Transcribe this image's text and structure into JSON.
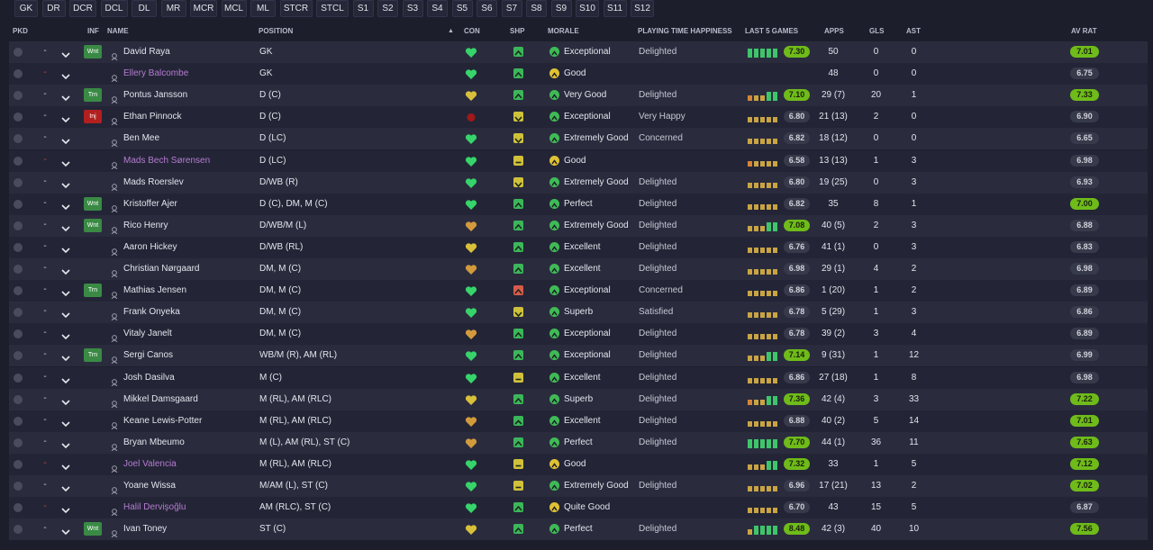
{
  "tabs": [
    "GK",
    "DR",
    "DCR",
    "DCL",
    "DL",
    "MR",
    "MCR",
    "MCL",
    "ML",
    "STCR",
    "STCL",
    "S1",
    "S2",
    "S3",
    "S4",
    "S5",
    "S6",
    "S7",
    "S8",
    "S9",
    "S10",
    "S11",
    "S12"
  ],
  "headers": {
    "pkd": "PKD",
    "inf": "INF",
    "name": "NAME",
    "position": "POSITION",
    "sort_arrow": "▲",
    "con": "CON",
    "shp": "SHP",
    "morale": "MORALE",
    "playing_time_happiness": "PLAYING TIME HAPPINESS",
    "last5": "LAST 5 GAMES",
    "apps": "APPS",
    "gls": "GLS",
    "ast": "AST",
    "avrat": "AV RAT"
  },
  "colors": {
    "accent_green": "#4caf50",
    "rating_green": "#6fbb1a",
    "rating_dark": "#373a4a",
    "loan_purple": "#b57bd1",
    "injury_red": "#b21f1f"
  },
  "players": [
    {
      "name": "David Raya",
      "loan": false,
      "status": "Wnt",
      "position": "GK",
      "con": "green",
      "shp": "up",
      "mood": "green",
      "morale": "Exceptional",
      "pth": "Delighted",
      "form": [
        3,
        3,
        3,
        3,
        3
      ],
      "avg": "7.30",
      "avg_hi": true,
      "apps": "50",
      "gls": "0",
      "ast": "0",
      "avrat": "7.01",
      "avrat_hi": true
    },
    {
      "name": "Ellery Balcombe",
      "loan": true,
      "status": "",
      "position": "GK",
      "con": "green",
      "shp": "up",
      "mood": "yellow",
      "morale": "Good",
      "pth": "",
      "form": [],
      "avg": "",
      "avg_hi": false,
      "apps": "48",
      "gls": "0",
      "ast": "0",
      "avrat": "6.75",
      "avrat_hi": false
    },
    {
      "name": "Pontus Jansson",
      "loan": false,
      "status": "Trn",
      "position": "D (C)",
      "con": "yellow",
      "shp": "up",
      "mood": "green",
      "morale": "Very Good",
      "pth": "Delighted",
      "form": [
        1,
        2,
        2,
        3,
        3
      ],
      "avg": "7.10",
      "avg_hi": true,
      "apps": "29 (7)",
      "gls": "20",
      "ast": "1",
      "avrat": "7.33",
      "avrat_hi": true
    },
    {
      "name": "Ethan Pinnock",
      "loan": false,
      "status": "Inj",
      "position": "D (C)",
      "con": "red",
      "shp": "down",
      "mood": "green",
      "morale": "Exceptional",
      "pth": "Very Happy",
      "form": [
        2,
        2,
        2,
        2,
        2
      ],
      "avg": "6.80",
      "avg_hi": false,
      "apps": "21 (13)",
      "gls": "2",
      "ast": "0",
      "avrat": "6.90",
      "avrat_hi": false
    },
    {
      "name": "Ben Mee",
      "loan": false,
      "status": "",
      "position": "D (LC)",
      "con": "green",
      "shp": "down",
      "mood": "green",
      "morale": "Extremely Good",
      "pth": "Concerned",
      "form": [
        2,
        2,
        2,
        2,
        2
      ],
      "avg": "6.82",
      "avg_hi": false,
      "apps": "18 (12)",
      "gls": "0",
      "ast": "0",
      "avrat": "6.65",
      "avrat_hi": false
    },
    {
      "name": "Mads Bech Sørensen",
      "loan": true,
      "status": "",
      "position": "D (LC)",
      "con": "green",
      "shp": "flat",
      "mood": "yellow",
      "morale": "Good",
      "pth": "",
      "form": [
        1,
        2,
        2,
        2,
        2
      ],
      "avg": "6.58",
      "avg_hi": false,
      "apps": "13 (13)",
      "gls": "1",
      "ast": "3",
      "avrat": "6.98",
      "avrat_hi": false
    },
    {
      "name": "Mads Roerslev",
      "loan": false,
      "status": "",
      "position": "D/WB (R)",
      "con": "green",
      "shp": "down",
      "mood": "green",
      "morale": "Extremely Good",
      "pth": "Delighted",
      "form": [
        2,
        2,
        2,
        2,
        2
      ],
      "avg": "6.80",
      "avg_hi": false,
      "apps": "19 (25)",
      "gls": "0",
      "ast": "3",
      "avrat": "6.93",
      "avrat_hi": false
    },
    {
      "name": "Kristoffer Ajer",
      "loan": false,
      "status": "Wnt",
      "position": "D (C), DM, M (C)",
      "con": "green",
      "shp": "up",
      "mood": "green",
      "morale": "Perfect",
      "pth": "Delighted",
      "form": [
        2,
        2,
        2,
        2,
        2
      ],
      "avg": "6.82",
      "avg_hi": false,
      "apps": "35",
      "gls": "8",
      "ast": "1",
      "avrat": "7.00",
      "avrat_hi": true
    },
    {
      "name": "Rico Henry",
      "loan": false,
      "status": "Wnt",
      "position": "D/WB/M (L)",
      "con": "orange",
      "shp": "up",
      "mood": "green",
      "morale": "Extremely Good",
      "pth": "Delighted",
      "form": [
        2,
        2,
        2,
        3,
        3
      ],
      "avg": "7.08",
      "avg_hi": true,
      "apps": "40 (5)",
      "gls": "2",
      "ast": "3",
      "avrat": "6.88",
      "avrat_hi": false
    },
    {
      "name": "Aaron Hickey",
      "loan": false,
      "status": "",
      "position": "D/WB (RL)",
      "con": "yellow",
      "shp": "up",
      "mood": "green",
      "morale": "Excellent",
      "pth": "Delighted",
      "form": [
        2,
        2,
        2,
        2,
        2
      ],
      "avg": "6.76",
      "avg_hi": false,
      "apps": "41 (1)",
      "gls": "0",
      "ast": "3",
      "avrat": "6.83",
      "avrat_hi": false
    },
    {
      "name": "Christian Nørgaard",
      "loan": false,
      "status": "",
      "position": "DM, M (C)",
      "con": "orange",
      "shp": "up",
      "mood": "green",
      "morale": "Excellent",
      "pth": "Delighted",
      "form": [
        2,
        2,
        2,
        2,
        2
      ],
      "avg": "6.98",
      "avg_hi": false,
      "apps": "29 (1)",
      "gls": "4",
      "ast": "2",
      "avrat": "6.98",
      "avrat_hi": false
    },
    {
      "name": "Mathias Jensen",
      "loan": false,
      "status": "Trn",
      "position": "DM, M (C)",
      "con": "green",
      "shp": "red",
      "mood": "green",
      "morale": "Exceptional",
      "pth": "Concerned",
      "form": [
        2,
        2,
        2,
        2,
        2
      ],
      "avg": "6.86",
      "avg_hi": false,
      "apps": "1 (20)",
      "gls": "1",
      "ast": "2",
      "avrat": "6.89",
      "avrat_hi": false
    },
    {
      "name": "Frank Onyeka",
      "loan": false,
      "status": "",
      "position": "DM, M (C)",
      "con": "green",
      "shp": "down",
      "mood": "green",
      "morale": "Superb",
      "pth": "Satisfied",
      "form": [
        2,
        2,
        2,
        2,
        2
      ],
      "avg": "6.78",
      "avg_hi": false,
      "apps": "5 (29)",
      "gls": "1",
      "ast": "3",
      "avrat": "6.86",
      "avrat_hi": false
    },
    {
      "name": "Vitaly Janelt",
      "loan": false,
      "status": "",
      "position": "DM, M (C)",
      "con": "orange",
      "shp": "up",
      "mood": "green",
      "morale": "Exceptional",
      "pth": "Delighted",
      "form": [
        2,
        2,
        2,
        2,
        2
      ],
      "avg": "6.78",
      "avg_hi": false,
      "apps": "39 (2)",
      "gls": "3",
      "ast": "4",
      "avrat": "6.89",
      "avrat_hi": false
    },
    {
      "name": "Sergi Canos",
      "loan": false,
      "status": "Trn",
      "position": "WB/M (R), AM (RL)",
      "con": "green",
      "shp": "up",
      "mood": "green",
      "morale": "Exceptional",
      "pth": "Delighted",
      "form": [
        2,
        2,
        2,
        3,
        3
      ],
      "avg": "7.14",
      "avg_hi": true,
      "apps": "9 (31)",
      "gls": "1",
      "ast": "12",
      "avrat": "6.99",
      "avrat_hi": false
    },
    {
      "name": "Josh Dasilva",
      "loan": false,
      "status": "",
      "position": "M (C)",
      "con": "green",
      "shp": "flat",
      "mood": "green",
      "morale": "Excellent",
      "pth": "Delighted",
      "form": [
        2,
        2,
        2,
        2,
        2
      ],
      "avg": "6.86",
      "avg_hi": false,
      "apps": "27 (18)",
      "gls": "1",
      "ast": "8",
      "avrat": "6.98",
      "avrat_hi": false
    },
    {
      "name": "Mikkel Damsgaard",
      "loan": false,
      "status": "",
      "position": "M (RL), AM (RLC)",
      "con": "yellow",
      "shp": "up",
      "mood": "green",
      "morale": "Superb",
      "pth": "Delighted",
      "form": [
        1,
        2,
        2,
        3,
        3
      ],
      "avg": "7.36",
      "avg_hi": true,
      "apps": "42 (4)",
      "gls": "3",
      "ast": "33",
      "avrat": "7.22",
      "avrat_hi": true
    },
    {
      "name": "Keane Lewis-Potter",
      "loan": false,
      "status": "",
      "position": "M (RL), AM (RLC)",
      "con": "orange",
      "shp": "upchev",
      "mood": "green",
      "morale": "Excellent",
      "pth": "Delighted",
      "form": [
        2,
        2,
        2,
        2,
        2
      ],
      "avg": "6.88",
      "avg_hi": false,
      "apps": "40 (2)",
      "gls": "5",
      "ast": "14",
      "avrat": "7.01",
      "avrat_hi": true
    },
    {
      "name": "Bryan Mbeumo",
      "loan": false,
      "status": "",
      "position": "M (L), AM (RL), ST (C)",
      "con": "orange",
      "shp": "up",
      "mood": "green",
      "morale": "Perfect",
      "pth": "Delighted",
      "form": [
        3,
        3,
        3,
        3,
        3
      ],
      "avg": "7.70",
      "avg_hi": true,
      "apps": "44 (1)",
      "gls": "36",
      "ast": "11",
      "avrat": "7.63",
      "avrat_hi": true
    },
    {
      "name": "Joel Valencia",
      "loan": true,
      "status": "",
      "position": "M (RL), AM (RLC)",
      "con": "green",
      "shp": "flat",
      "mood": "yellow",
      "morale": "Good",
      "pth": "",
      "form": [
        2,
        2,
        2,
        3,
        3
      ],
      "avg": "7.32",
      "avg_hi": true,
      "apps": "33",
      "gls": "1",
      "ast": "5",
      "avrat": "7.12",
      "avrat_hi": true
    },
    {
      "name": "Yoane Wissa",
      "loan": false,
      "status": "",
      "position": "M/AM (L), ST (C)",
      "con": "green",
      "shp": "flat",
      "mood": "green",
      "morale": "Extremely Good",
      "pth": "Delighted",
      "form": [
        2,
        2,
        2,
        2,
        2
      ],
      "avg": "6.96",
      "avg_hi": false,
      "apps": "17 (21)",
      "gls": "13",
      "ast": "2",
      "avrat": "7.02",
      "avrat_hi": true
    },
    {
      "name": "Halil Dervişoğlu",
      "loan": true,
      "status": "",
      "position": "AM (RLC), ST (C)",
      "con": "green",
      "shp": "up",
      "mood": "yellow",
      "morale": "Quite Good",
      "pth": "",
      "form": [
        2,
        2,
        2,
        2,
        2
      ],
      "avg": "6.70",
      "avg_hi": false,
      "apps": "43",
      "gls": "15",
      "ast": "5",
      "avrat": "6.87",
      "avrat_hi": false
    },
    {
      "name": "Ivan Toney",
      "loan": false,
      "status": "Wnt",
      "position": "ST (C)",
      "con": "yellow",
      "shp": "up",
      "mood": "green",
      "morale": "Perfect",
      "pth": "Delighted",
      "form": [
        2,
        3,
        3,
        3,
        3
      ],
      "avg": "8.48",
      "avg_hi": true,
      "apps": "42 (3)",
      "gls": "40",
      "ast": "10",
      "avrat": "7.56",
      "avrat_hi": true
    }
  ]
}
